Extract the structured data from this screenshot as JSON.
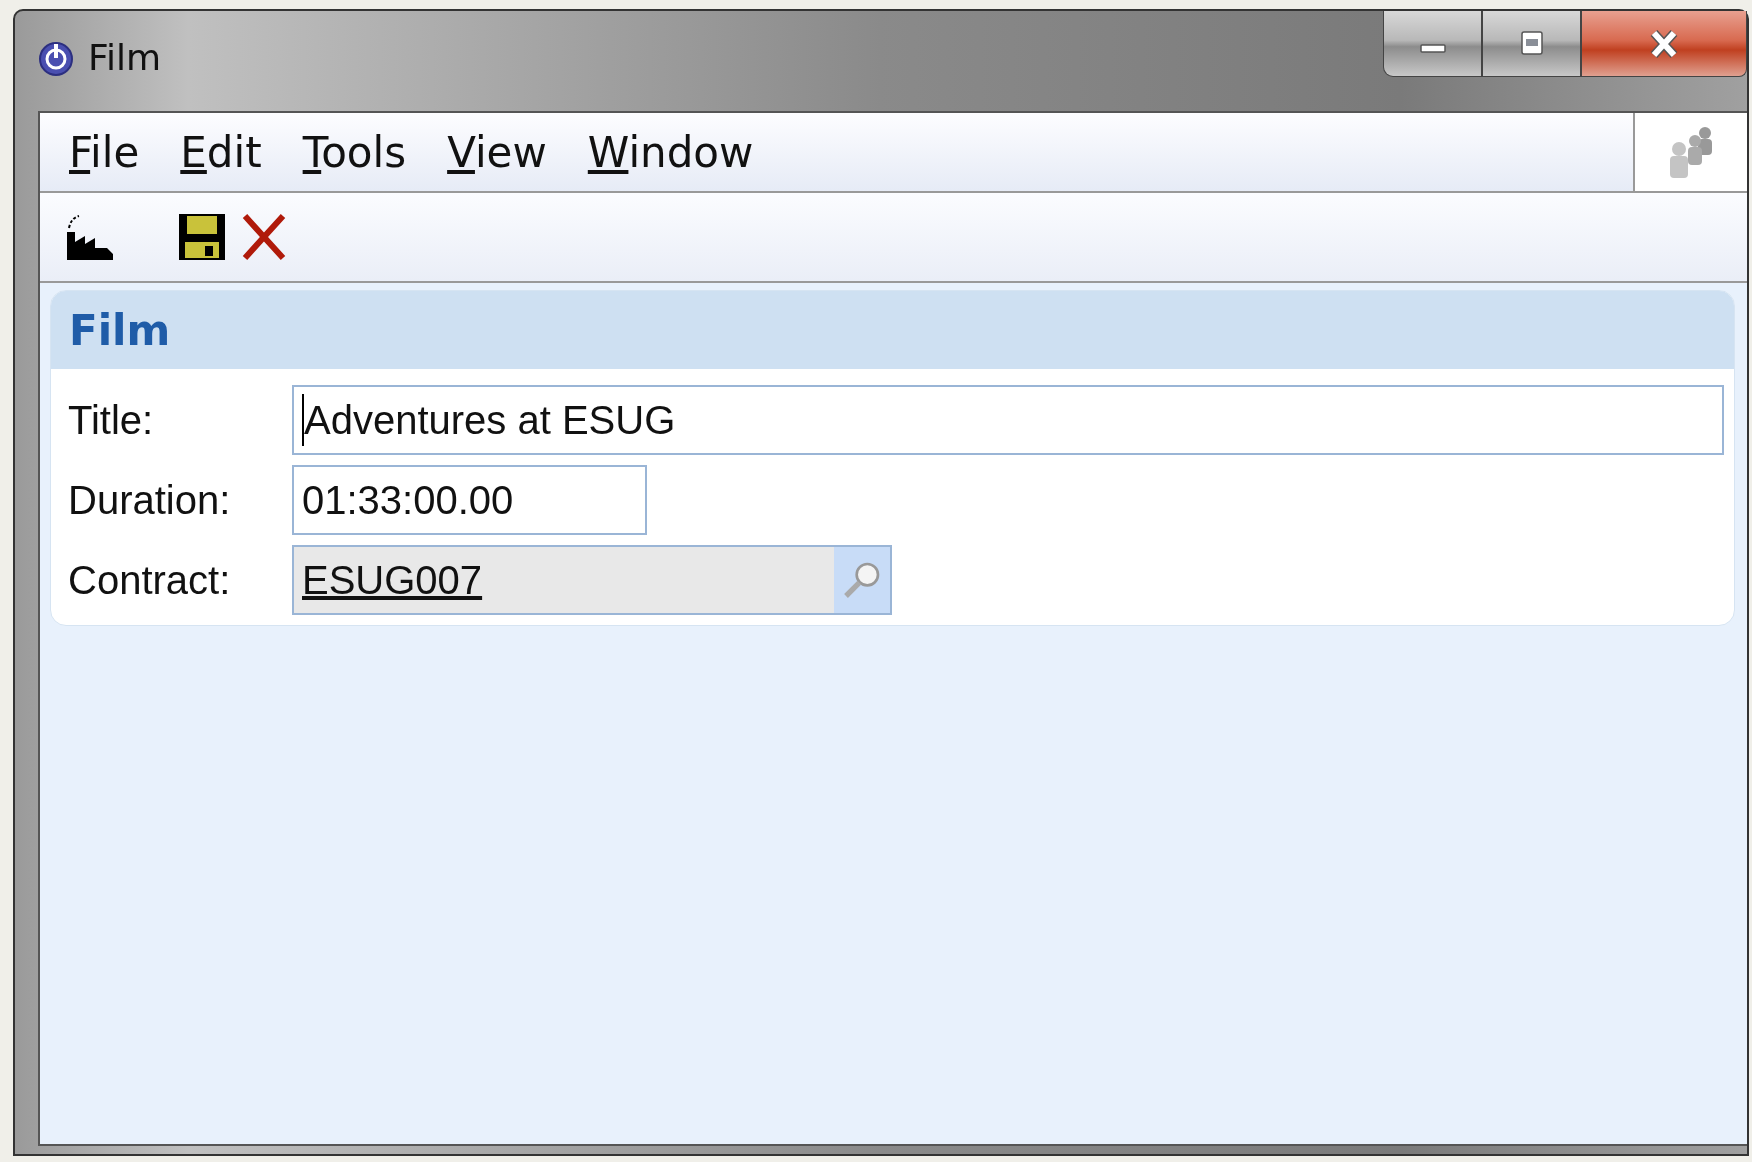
{
  "window": {
    "title": "Film"
  },
  "menu": [
    {
      "label": "File"
    },
    {
      "label": "Edit"
    },
    {
      "label": "Tools"
    },
    {
      "label": "View"
    },
    {
      "label": "Window"
    }
  ],
  "panel": {
    "heading": "Film",
    "fields": [
      {
        "kind": "text",
        "label": "Title:",
        "value": "Adventures at ESUG",
        "focused": true
      },
      {
        "kind": "short",
        "label": "Duration:",
        "value": "01:33:00.00",
        "focused": false
      },
      {
        "kind": "lookup",
        "label": "Contract:",
        "value": "ESUG007",
        "focused": false
      }
    ]
  }
}
